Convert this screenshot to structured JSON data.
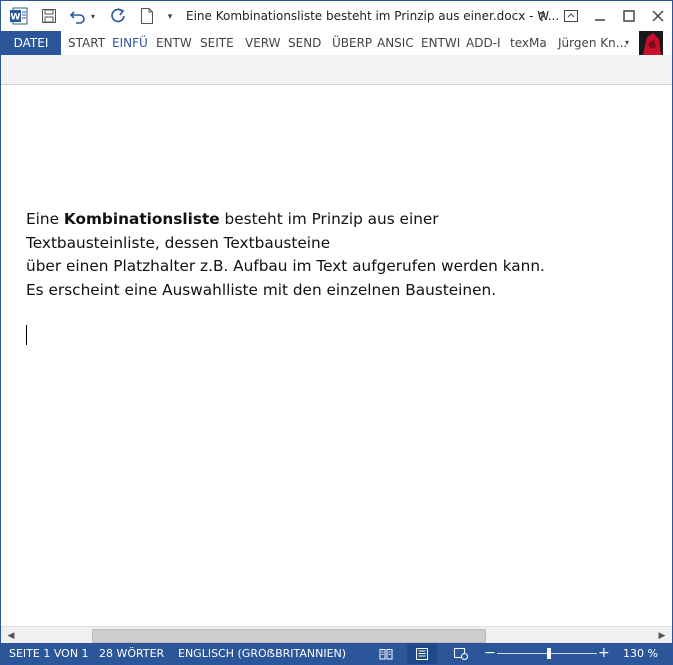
{
  "window": {
    "title": "Eine Kombinationsliste besteht im Prinzip aus einer.docx - W...",
    "help_icon": "question-mark-icon",
    "accent": "#2b579a"
  },
  "quick_access": {
    "icons": [
      "word-logo-icon",
      "save-icon",
      "undo-icon",
      "undo-dropdown-icon",
      "redo-icon",
      "new-document-icon",
      "customize-dropdown-icon"
    ]
  },
  "ribbon": {
    "tabs": [
      "DATEI",
      "START",
      "EINFÜ",
      "ENTW",
      "SEITE",
      "VERW",
      "SEND",
      "ÜBERP",
      "ANSIC",
      "ENTWI",
      "ADD-I",
      "texMa"
    ],
    "active_tab": "EINFÜ",
    "user": "Jürgen Kn..."
  },
  "document": {
    "lines": [
      {
        "before": "Eine ",
        "bold": "Kombinationsliste",
        "after": " besteht im Prinzip aus einer"
      },
      {
        "text": "Textbausteinliste, dessen Textbausteine"
      },
      {
        "text": "über einen Platzhalter z.B. Aufbau im Text aufgerufen werden kann."
      },
      {
        "text": "Es erscheint eine Auswahlliste mit den einzelnen Bausteinen."
      }
    ]
  },
  "statusbar": {
    "page": "SEITE 1 VON 1",
    "words": "28 WÖRTER",
    "language": "ENGLISCH (GROẞBRITANNIEN)",
    "zoom": "130 %",
    "view_icons": [
      "read-mode-icon",
      "print-layout-icon",
      "web-layout-icon"
    ]
  }
}
